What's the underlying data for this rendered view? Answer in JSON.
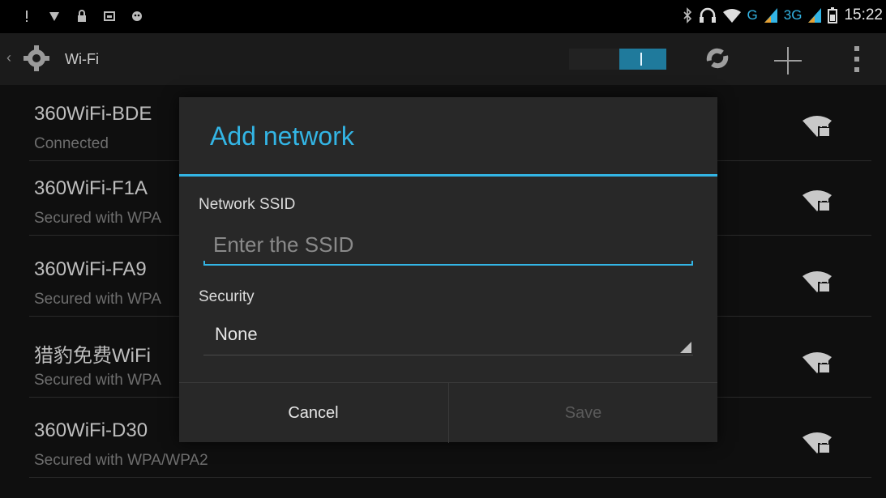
{
  "status_bar": {
    "time": "15:22",
    "network_g": "G",
    "network_3g": "3G",
    "icons": [
      "alert-icon",
      "signal-icon",
      "lock-icon",
      "image-icon",
      "notification-icon",
      "bluetooth-icon",
      "headset-icon",
      "wifi-icon",
      "signal-icon",
      "battery-icon"
    ]
  },
  "action_bar": {
    "title": "Wi-Fi",
    "toggle_on": true,
    "actions": [
      "wps-icon",
      "add-icon",
      "overflow-icon"
    ]
  },
  "networks": [
    {
      "ssid": "360WiFi-BDE",
      "status": "Connected"
    },
    {
      "ssid": "360WiFi-F1A",
      "status": "Secured with WPA"
    },
    {
      "ssid": "360WiFi-FA9",
      "status": "Secured with WPA"
    },
    {
      "ssid": "猎豹免费WiFi",
      "status": "Secured with WPA"
    },
    {
      "ssid": "360WiFi-D30",
      "status": "Secured with WPA/WPA2"
    }
  ],
  "dialog": {
    "title": "Add network",
    "ssid_label": "Network SSID",
    "ssid_placeholder": "Enter the SSID",
    "ssid_value": "",
    "security_label": "Security",
    "security_value": "None",
    "cancel_label": "Cancel",
    "save_label": "Save"
  },
  "colors": {
    "accent": "#33b5e5",
    "background": "#0f0f0f",
    "dialog": "#282828"
  }
}
